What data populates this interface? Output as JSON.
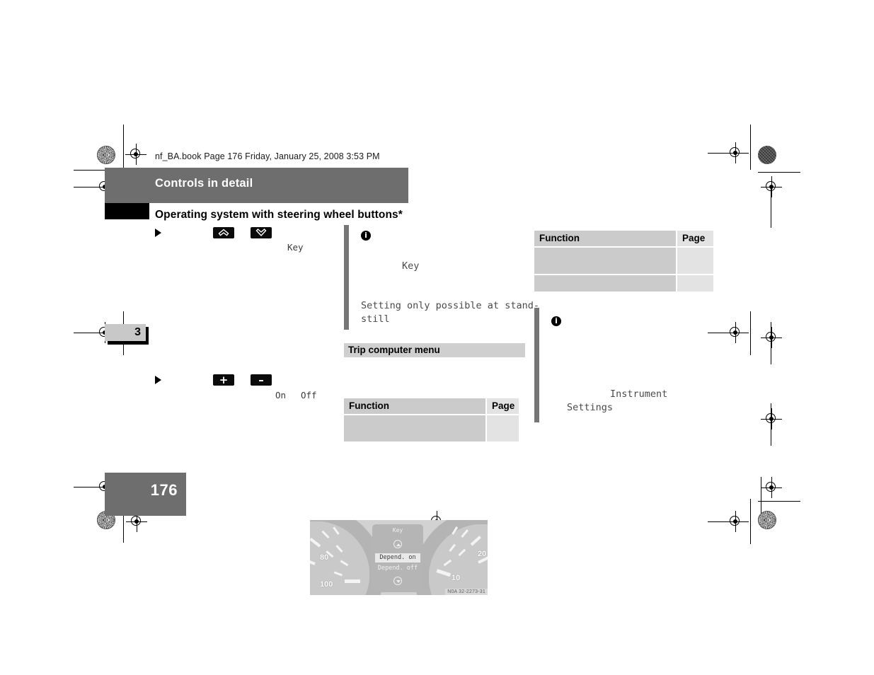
{
  "page": {
    "file_info": "nf_BA.book  Page 176  Friday, January 25, 2008  3:53 PM",
    "chapter_band_title": "Controls in detail",
    "section_title": "Operating system with steering wheel buttons*",
    "chapter_number": "3",
    "page_number": "176"
  },
  "column_left": {
    "step_1": {
      "bullet": "triangle-bullet",
      "button_up": "↑",
      "button_down": "↓",
      "mono_label": "Key"
    },
    "cluster_image": {
      "display_title": "Key",
      "option_selected": "Depend. on",
      "option_other": "Depend. off",
      "dial_left_numbers": [
        "80",
        "100"
      ],
      "dial_right_numbers": [
        "20",
        "10"
      ],
      "reference_code": "N0A 32-2273-31"
    },
    "step_2": {
      "bullet": "triangle-bullet",
      "button_plus": "+",
      "button_minus": "–",
      "mono_label_on": "On",
      "mono_label_off": "Off"
    }
  },
  "column_middle": {
    "note": {
      "icon": "info-icon",
      "line_1": "Key",
      "line_2": "Setting only possible at stand-",
      "line_3": "still"
    },
    "subsection_title": "Trip computer menu",
    "table": {
      "headers": [
        "Function",
        "Page"
      ],
      "rows": [
        {
          "function": "",
          "page": ""
        }
      ]
    }
  },
  "column_right": {
    "table": {
      "headers": [
        "Function",
        "Page"
      ],
      "rows": [
        {
          "function": "",
          "page": ""
        },
        {
          "function": "",
          "page": ""
        }
      ]
    },
    "note": {
      "icon": "info-icon",
      "line_1": "Instrument",
      "line_2": "Settings"
    }
  },
  "colors": {
    "band_gray": "#6e6e6e",
    "tab_gray": "#c8c8c8",
    "table_function_cell": "#cbcbcb",
    "table_page_cell": "#e3e3e3",
    "subsection_bar": "#cfcfcf",
    "note_rule": "#767676",
    "text_black": "#000000",
    "mono_text": "#4a4a4a"
  }
}
